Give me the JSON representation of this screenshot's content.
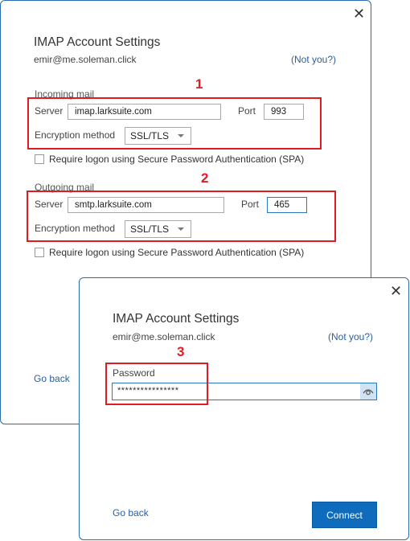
{
  "dialog1": {
    "title": "IMAP Account Settings",
    "email": "emir@me.soleman.click",
    "not_you": "(Not you?)",
    "close_icon": "close-icon",
    "incoming": {
      "section_label": "Incoming mail",
      "server_label": "Server",
      "server_value": "imap.larksuite.com",
      "port_label": "Port",
      "port_value": "993",
      "encryption_label": "Encryption method",
      "encryption_value": "SSL/TLS",
      "spa_label": "Require logon using Secure Password Authentication (SPA)",
      "spa_checked": false
    },
    "outgoing": {
      "section_label": "Outgoing mail",
      "server_label": "Server",
      "server_value": "smtp.larksuite.com",
      "port_label": "Port",
      "port_value": "465",
      "encryption_label": "Encryption method",
      "encryption_value": "SSL/TLS",
      "spa_label": "Require logon using Secure Password Authentication (SPA)",
      "spa_checked": false
    },
    "go_back": "Go back"
  },
  "dialog2": {
    "title": "IMAP Account Settings",
    "email": "emir@me.soleman.click",
    "not_you": "(Not you?)",
    "close_icon": "close-icon",
    "password_label": "Password",
    "password_value": "****************",
    "show_password_icon": "eye-icon",
    "go_back": "Go back",
    "connect": "Connect"
  },
  "annotations": {
    "step1": "1",
    "step2": "2",
    "step3": "3",
    "color": "#e01b24"
  },
  "colors": {
    "accent": "#0f6cbd",
    "link": "#2a5f9e"
  }
}
